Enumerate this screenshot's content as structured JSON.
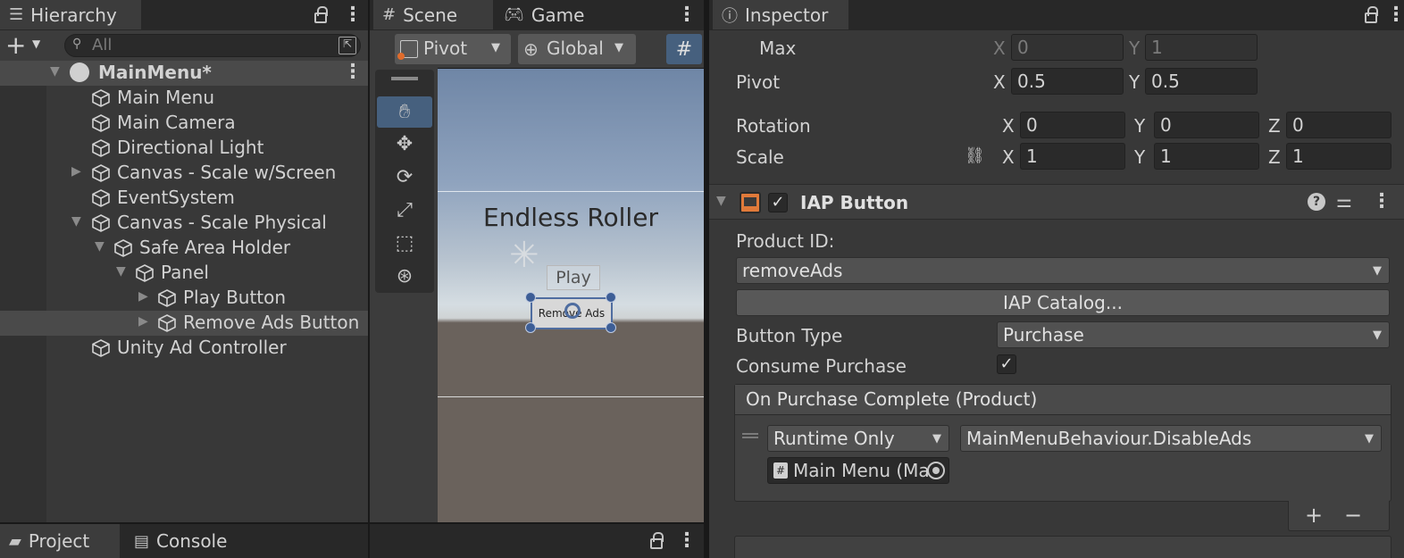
{
  "hierarchy": {
    "tab_label": "Hierarchy",
    "search_placeholder": "All",
    "scene_name": "MainMenu*",
    "items": [
      {
        "label": "Main Menu"
      },
      {
        "label": "Main Camera"
      },
      {
        "label": "Directional Light"
      },
      {
        "label": "Canvas - Scale w/Screen"
      },
      {
        "label": "EventSystem"
      },
      {
        "label": "Canvas - Scale Physical"
      },
      {
        "label": "Safe Area Holder"
      },
      {
        "label": "Panel"
      },
      {
        "label": "Play Button"
      },
      {
        "label": "Remove Ads Button"
      },
      {
        "label": "Unity Ad Controller"
      }
    ]
  },
  "scene": {
    "tabs": [
      {
        "label": "Scene"
      },
      {
        "label": "Game"
      }
    ],
    "pivot_label": "Pivot",
    "global_label": "Global",
    "game_title": "Endless Roller",
    "play_label": "Play",
    "remove_ads_label": "Remove Ads"
  },
  "inspector": {
    "tab_label": "Inspector",
    "max_label": "Max",
    "max_x": "0",
    "max_y": "1",
    "pivot_label": "Pivot",
    "pivot_x": "0.5",
    "pivot_y": "0.5",
    "rotation_label": "Rotation",
    "rotation": {
      "x": "0",
      "y": "0",
      "z": "0"
    },
    "scale_label": "Scale",
    "scale": {
      "x": "1",
      "y": "1",
      "z": "1"
    },
    "axis": {
      "x": "X",
      "y": "Y",
      "z": "Z"
    },
    "component_title": "IAP Button",
    "product_id_label": "Product ID:",
    "product_id_value": "removeAds",
    "catalog_button": "IAP Catalog...",
    "button_type_label": "Button Type",
    "button_type_value": "Purchase",
    "consume_label": "Consume Purchase",
    "consume_checked": true,
    "event_header": "On Purchase Complete (Product)",
    "runtime_value": "Runtime Only",
    "function_value": "MainMenuBehaviour.DisableAds",
    "object_value": "Main Menu (Ma",
    "add_label": "+",
    "remove_label": "−"
  },
  "bottom": {
    "tabs": [
      {
        "label": "Project"
      },
      {
        "label": "Console"
      }
    ]
  }
}
